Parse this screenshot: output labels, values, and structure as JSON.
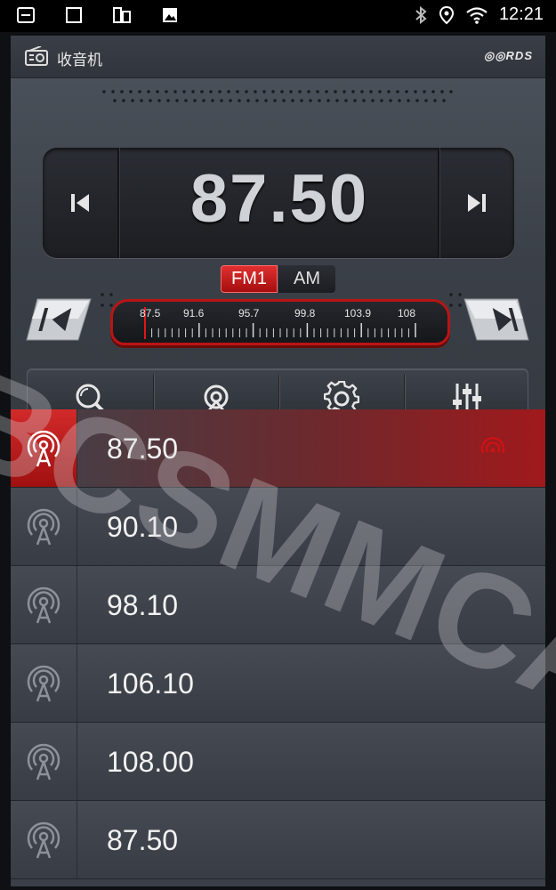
{
  "status_bar": {
    "time": "12:21",
    "left_icons": [
      "menu-icon",
      "square-icon",
      "dual-window-icon",
      "image-icon"
    ],
    "right_icons": [
      "bluetooth-icon",
      "location-icon",
      "wifi-icon"
    ]
  },
  "header": {
    "title": "收音机",
    "rds_logo": "RDS"
  },
  "tuner": {
    "frequency": "87.50",
    "bands": [
      "FM1",
      "AM"
    ],
    "active_band": "FM1",
    "scale_labels": [
      "87.5",
      "91.6",
      "95.7",
      "99.8",
      "103.9",
      "108"
    ],
    "scale_position_fraction": 0.0
  },
  "toolbar": {
    "tools": [
      "search-icon",
      "scan-station-icon",
      "settings-gear-icon",
      "equalizer-icon"
    ]
  },
  "presets": [
    {
      "frequency": "87.50",
      "active": true
    },
    {
      "frequency": "90.10",
      "active": false
    },
    {
      "frequency": "98.10",
      "active": false
    },
    {
      "frequency": "106.10",
      "active": false
    },
    {
      "frequency": "108.00",
      "active": false
    },
    {
      "frequency": "87.50",
      "active": false
    }
  ],
  "watermark": "BCSMMCAR",
  "colors": {
    "accent": "#c81414",
    "panel": "#3a3f48",
    "display": "#1c1e22"
  }
}
